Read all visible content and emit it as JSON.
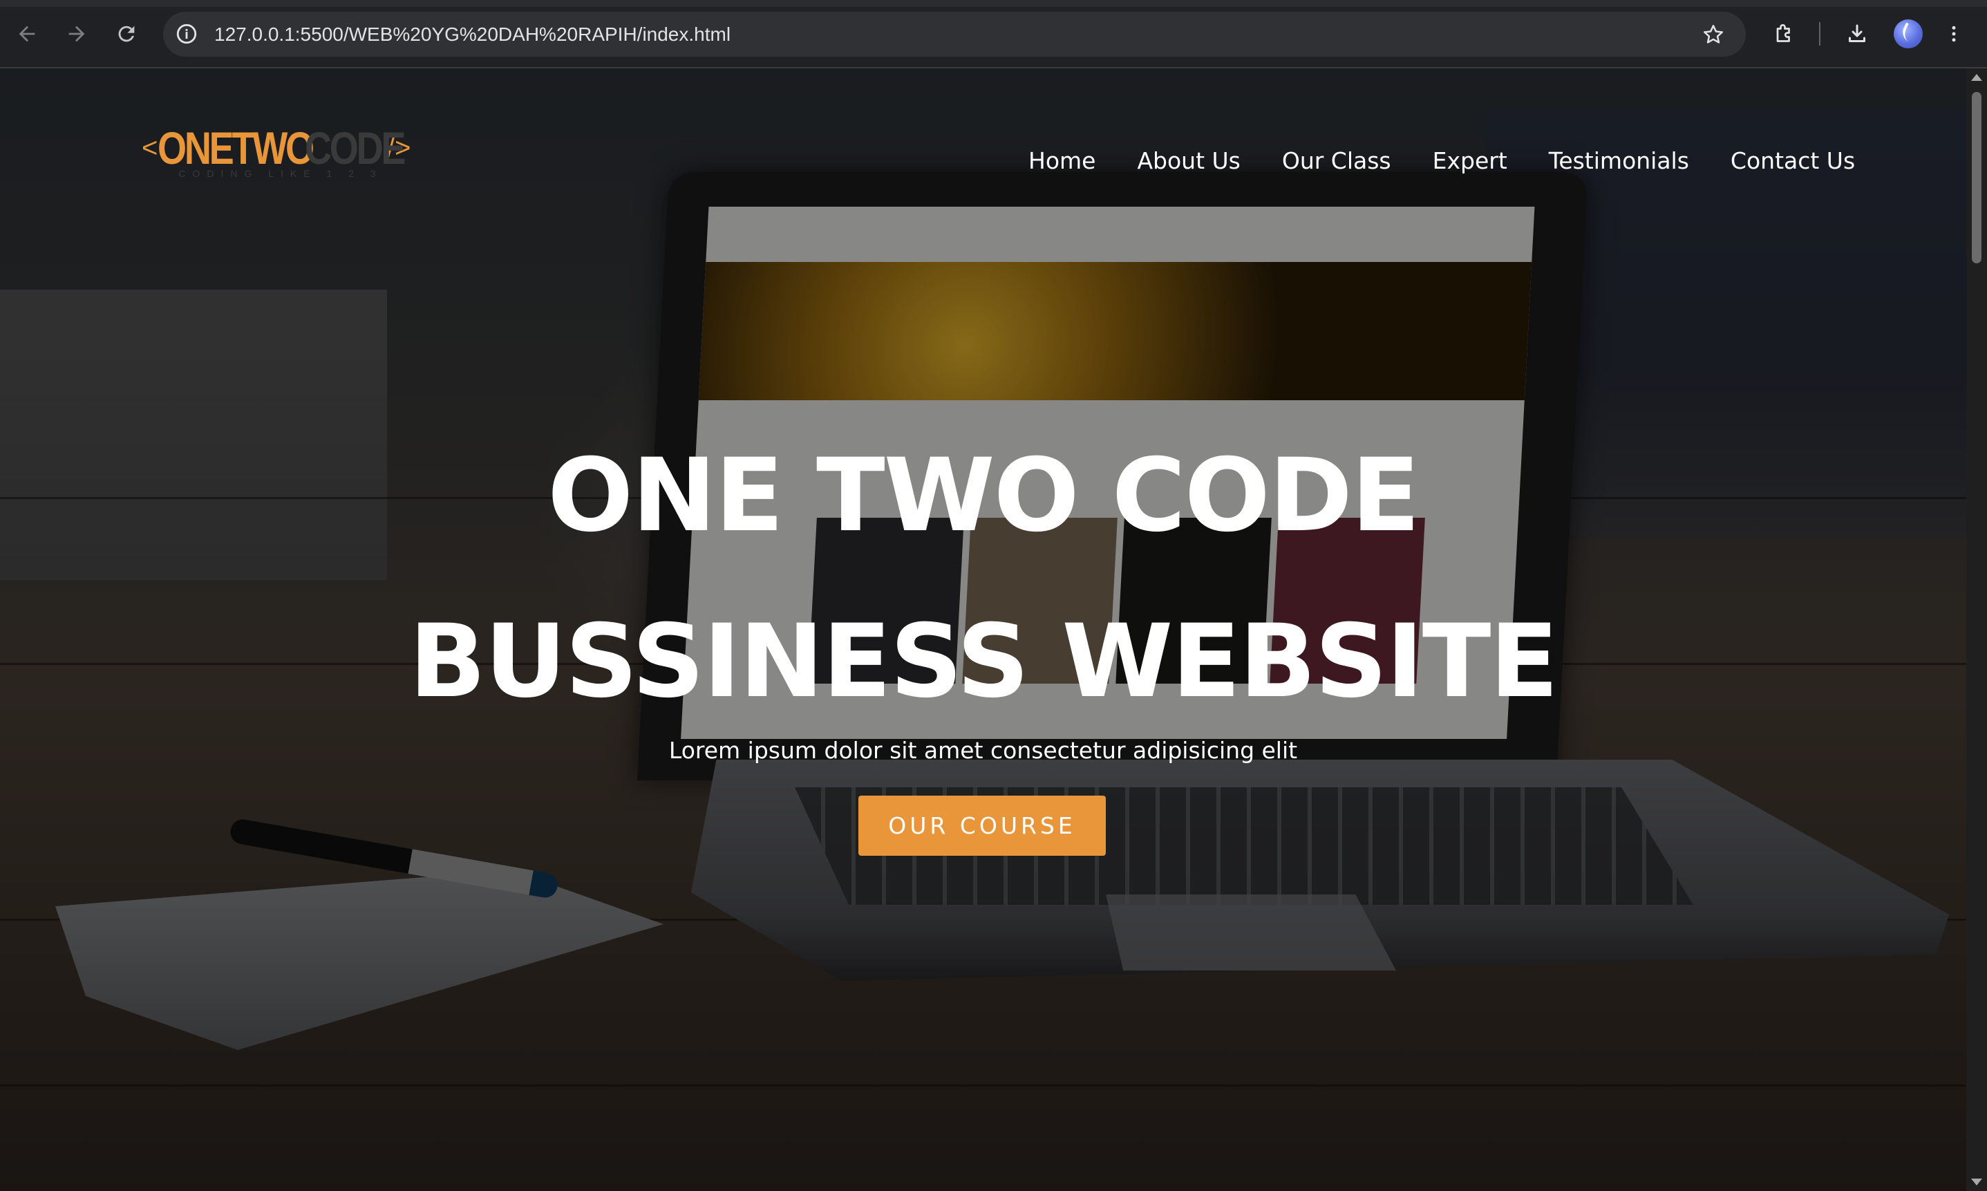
{
  "browser": {
    "url": "127.0.0.1:5500/WEB%20YG%20DAH%20RAPIH/index.html",
    "icons": {
      "back": "arrow-left-icon",
      "forward": "arrow-right-icon",
      "reload": "reload-icon",
      "site_info": "info-icon",
      "bookmark": "star-icon",
      "extensions": "puzzle-icon",
      "downloads": "download-icon",
      "profile": "avatar",
      "menu": "kebab-menu-icon"
    }
  },
  "site": {
    "logo": {
      "bracket_left": "<",
      "word1": "ONETWO",
      "word2": "CODE",
      "bracket_right": "/>",
      "tagline": "CODING LIKE 1 2 3"
    },
    "nav": [
      {
        "label": "Home"
      },
      {
        "label": "About Us"
      },
      {
        "label": "Our Class"
      },
      {
        "label": "Expert"
      },
      {
        "label": "Testimonials"
      },
      {
        "label": "Contact Us"
      }
    ],
    "hero": {
      "title_line1": "ONE TWO CODE",
      "title_line2": "BUSSINESS WEBSITE",
      "subtitle": "Lorem ipsum dolor sit amet consectetur adipisicing elit",
      "cta_label": "OUR COURSE"
    },
    "colors": {
      "accent": "#e9963a",
      "text": "#ffffff"
    }
  }
}
